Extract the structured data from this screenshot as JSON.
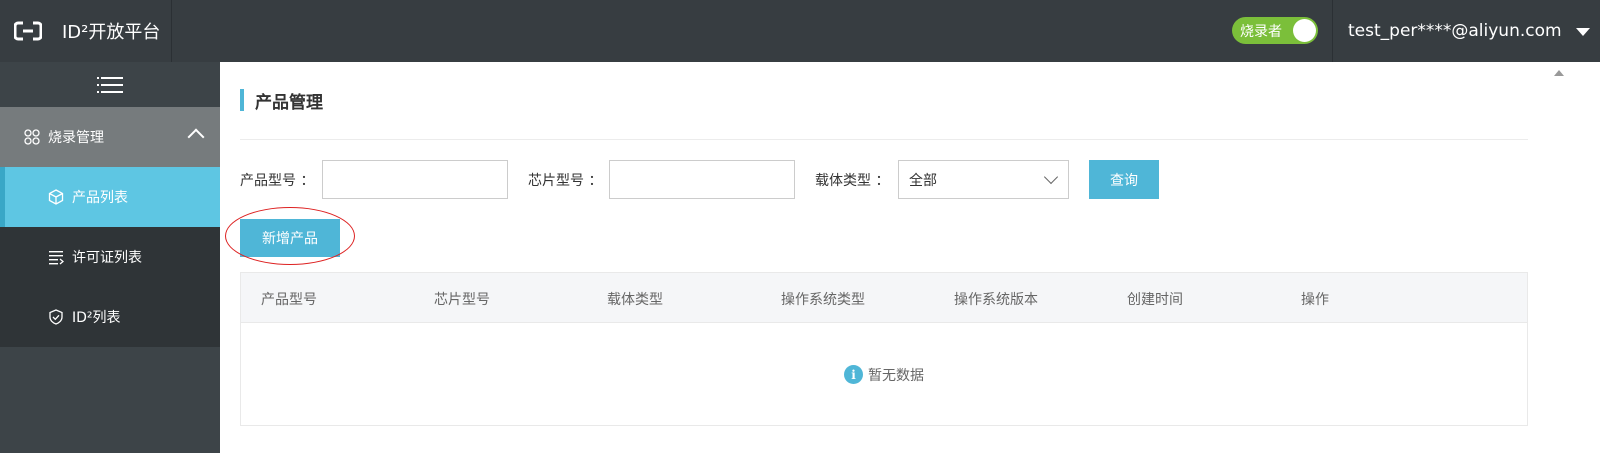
{
  "header": {
    "title": "ID²开放平台",
    "role_toggle_label": "烧录者",
    "user_email": "test_per****@aliyun.com"
  },
  "sidebar": {
    "group_label": "烧录管理",
    "items": [
      {
        "label": "产品列表",
        "active": true
      },
      {
        "label": "许可证列表",
        "active": false
      },
      {
        "label": "ID²列表",
        "active": false
      }
    ]
  },
  "main": {
    "page_title": "产品管理",
    "filters": {
      "product_model_label": "产品型号 ：",
      "chip_model_label": "芯片型号 ：",
      "carrier_type_label": "载体类型 ：",
      "carrier_type_value": "全部",
      "query_label": "查询"
    },
    "add_product_label": "新增产品",
    "table": {
      "columns": [
        "产品型号",
        "芯片型号",
        "载体类型",
        "操作系统类型",
        "操作系统版本",
        "创建时间",
        "操作"
      ],
      "empty_text": "暂无数据"
    }
  },
  "colors": {
    "accent": "#4fb6d7",
    "topbar": "#373d41",
    "toggle_on": "#7bbf3a",
    "highlight_annotation": "#dd2222"
  }
}
